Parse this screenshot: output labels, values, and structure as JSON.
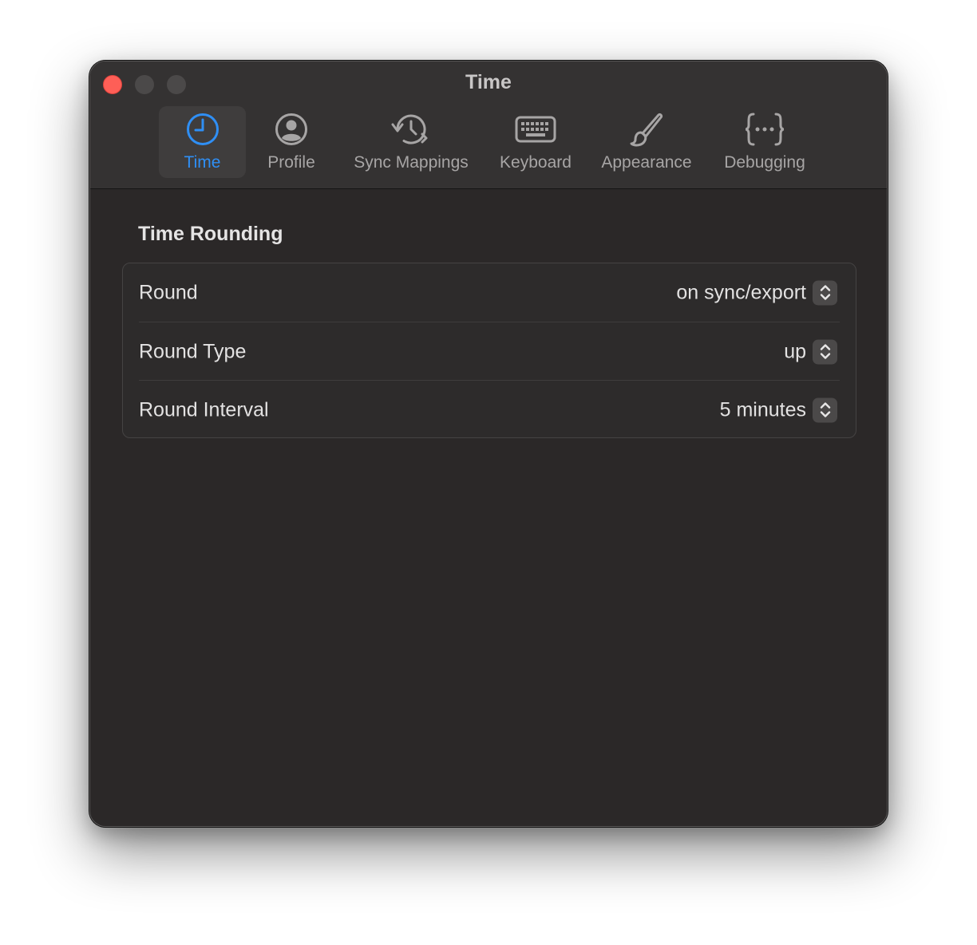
{
  "window": {
    "title": "Time"
  },
  "toolbar": {
    "tabs": [
      {
        "label": "Time",
        "icon": "clock-icon",
        "active": true
      },
      {
        "label": "Profile",
        "icon": "person-circle-icon",
        "active": false
      },
      {
        "label": "Sync Mappings",
        "icon": "clock-arrow-sync-icon",
        "active": false
      },
      {
        "label": "Keyboard",
        "icon": "keyboard-icon",
        "active": false
      },
      {
        "label": "Appearance",
        "icon": "paintbrush-icon",
        "active": false
      },
      {
        "label": "Debugging",
        "icon": "curly-braces-icon",
        "active": false
      }
    ]
  },
  "section": {
    "title": "Time Rounding",
    "rows": [
      {
        "label": "Round",
        "value": "on sync/export"
      },
      {
        "label": "Round Type",
        "value": "up"
      },
      {
        "label": "Round Interval",
        "value": "5 minutes"
      }
    ]
  },
  "colors": {
    "accent": "#2f8ff5",
    "close_button": "#fe5f57",
    "window_background": "#2b2828",
    "toolbar_background": "#343232"
  }
}
